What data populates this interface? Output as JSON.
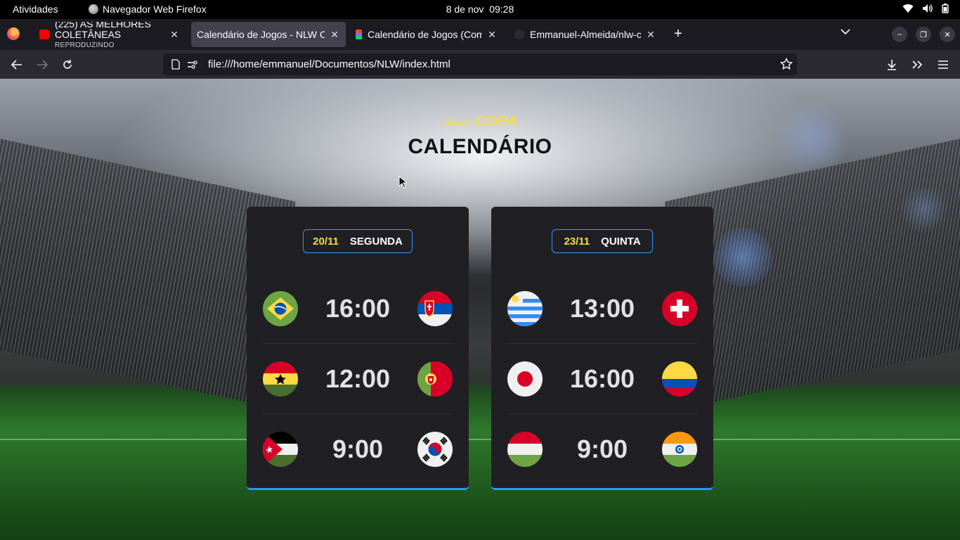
{
  "topbar": {
    "activities": "Atividades",
    "app_name": "Navegador Web Firefox",
    "date": "8 de nov",
    "time": "09:28"
  },
  "tabs": [
    {
      "title": "(225) AS MELHORES COLETÂNEAS",
      "subtitle": "REPRODUZINDO",
      "icon": "youtube-icon",
      "active": false
    },
    {
      "title": "Calendário de Jogos - NLW Copa",
      "icon": "none",
      "active": true
    },
    {
      "title": "Calendário de Jogos (Community)",
      "icon": "figma-icon",
      "active": false
    },
    {
      "title": "Emmanuel-Almeida/nlw-copa",
      "icon": "github-icon",
      "active": false
    }
  ],
  "navbar": {
    "url": "file:///home/emmanuel/Documentos/NLW/index.html"
  },
  "page": {
    "brand_small": "<nlw/>",
    "brand_big": "COPA",
    "title": "CALENDÁRIO",
    "cards": [
      {
        "date": "20/11",
        "weekday": "SEGUNDA",
        "games": [
          {
            "time": "16:00",
            "home": "brazil",
            "away": "serbia"
          },
          {
            "time": "12:00",
            "home": "ghana",
            "away": "portugal"
          },
          {
            "time": "9:00",
            "home": "jordan",
            "away": "south-korea"
          }
        ]
      },
      {
        "date": "23/11",
        "weekday": "QUINTA",
        "games": [
          {
            "time": "13:00",
            "home": "uruguay",
            "away": "switzerland"
          },
          {
            "time": "16:00",
            "home": "japan",
            "away": "colombia"
          },
          {
            "time": "9:00",
            "home": "hungary",
            "away": "india"
          }
        ]
      }
    ]
  },
  "colors": {
    "accent_yellow": "#f7dd43",
    "accent_blue": "#3294f8",
    "card_bg": "#202024",
    "time_text": "#e1e1e6"
  }
}
